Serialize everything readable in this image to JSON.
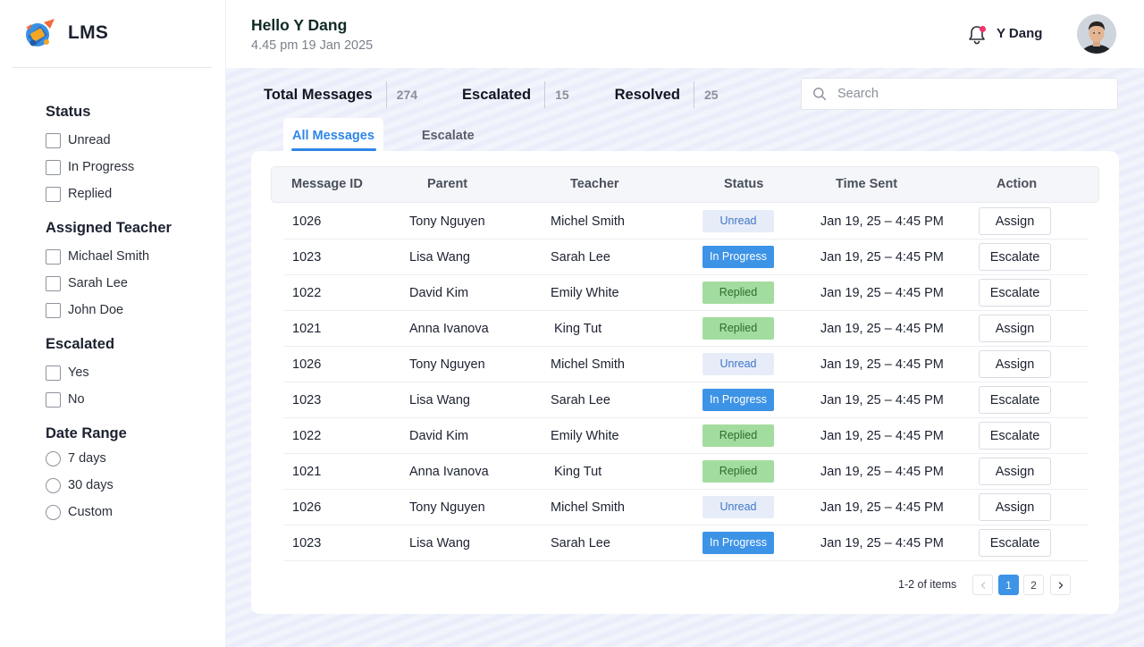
{
  "app": {
    "name": "LMS"
  },
  "sidebar": {
    "groups": [
      {
        "title": "Status",
        "type": "checkbox",
        "options": [
          "Unread",
          "In Progress",
          "Replied"
        ]
      },
      {
        "title": "Assigned Teacher",
        "type": "checkbox",
        "options": [
          "Michael Smith",
          "Sarah Lee",
          "John Doe"
        ]
      },
      {
        "title": "Escalated",
        "type": "checkbox",
        "options": [
          "Yes",
          "No"
        ]
      },
      {
        "title": "Date Range",
        "type": "radio",
        "options": [
          "7 days",
          "30 days",
          "Custom"
        ]
      }
    ]
  },
  "header": {
    "greeting": "Hello Y Dang",
    "datetime": "4.45 pm 19 Jan 2025",
    "username": "Y Dang",
    "bell_icon": "bell-icon"
  },
  "stats": [
    {
      "label": "Total Messages",
      "value": "274"
    },
    {
      "label": "Escalated",
      "value": "15"
    },
    {
      "label": "Resolved",
      "value": "25"
    }
  ],
  "search": {
    "placeholder": "Search",
    "value": ""
  },
  "tabs": [
    {
      "label": "All Messages",
      "active": true
    },
    {
      "label": "Escalate",
      "active": false
    }
  ],
  "table": {
    "columns": [
      "Message ID",
      "Parent",
      "Teacher",
      "Status",
      "Time Sent",
      "Action"
    ],
    "rows": [
      {
        "id": "1026",
        "parent": "Tony Nguyen",
        "teacher": "Michel Smith",
        "status": "Unread",
        "status_type": "unread",
        "time": "Jan 19, 25 – 4:45 PM",
        "action": "Assign"
      },
      {
        "id": "1023",
        "parent": "Lisa Wang",
        "teacher": "Sarah Lee",
        "status": "In Progress",
        "status_type": "progress",
        "time": "Jan 19, 25 – 4:45 PM",
        "action": "Escalate"
      },
      {
        "id": "1022",
        "parent": "David Kim",
        "teacher": "Emily White",
        "status": "Replied",
        "status_type": "replied",
        "time": "Jan 19, 25 – 4:45 PM",
        "action": "Escalate"
      },
      {
        "id": "1021",
        "parent": "Anna Ivanova",
        "teacher": "King Tut",
        "status": "Replied",
        "status_type": "replied",
        "time": "Jan 19, 25 – 4:45 PM",
        "action": "Assign"
      },
      {
        "id": "1026",
        "parent": "Tony Nguyen",
        "teacher": "Michel Smith",
        "status": "Unread",
        "status_type": "unread",
        "time": "Jan 19, 25 – 4:45 PM",
        "action": "Assign"
      },
      {
        "id": "1023",
        "parent": "Lisa Wang",
        "teacher": "Sarah Lee",
        "status": "In Progress",
        "status_type": "progress",
        "time": "Jan 19, 25 – 4:45 PM",
        "action": "Escalate"
      },
      {
        "id": "1022",
        "parent": "David Kim",
        "teacher": "Emily White",
        "status": "Replied",
        "status_type": "replied",
        "time": "Jan 19, 25 – 4:45 PM",
        "action": "Escalate"
      },
      {
        "id": "1021",
        "parent": "Anna Ivanova",
        "teacher": "King Tut",
        "status": "Replied",
        "status_type": "replied",
        "time": "Jan 19, 25 – 4:45 PM",
        "action": "Assign"
      },
      {
        "id": "1026",
        "parent": "Tony Nguyen",
        "teacher": "Michel Smith",
        "status": "Unread",
        "status_type": "unread",
        "time": "Jan 19, 25 – 4:45 PM",
        "action": "Assign"
      },
      {
        "id": "1023",
        "parent": "Lisa Wang",
        "teacher": "Sarah Lee",
        "status": "In Progress",
        "status_type": "progress",
        "time": "Jan 19, 25 – 4:45 PM",
        "action": "Escalate"
      }
    ]
  },
  "pagination": {
    "info": "1-2 of items",
    "pages": [
      "1",
      "2"
    ],
    "current": "1",
    "prev_icon": "chevron-left-icon",
    "next_icon": "chevron-right-icon"
  },
  "colors": {
    "accent": "#2f86e8",
    "unread_bg": "#e7edf8",
    "progress_bg": "#3d93e6",
    "replied_bg": "#a3dc9f",
    "notification_dot": "#f0346c"
  }
}
